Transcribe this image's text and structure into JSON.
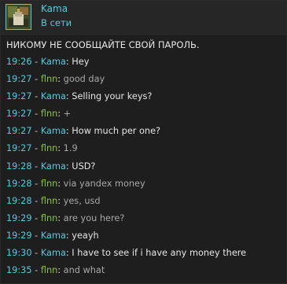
{
  "contact": {
    "name": "Kama",
    "status": "В сети"
  },
  "warning": "НИКОМУ НЕ СООБЩАЙТЕ СВОЙ ПАРОЛЬ.",
  "separator": " - ",
  "colon": ":",
  "messages": [
    {
      "time": "19:26",
      "author": "Kama",
      "text": "Hey"
    },
    {
      "time": "19:27",
      "author": "flnn",
      "text": "good day"
    },
    {
      "time": "19:27",
      "author": "Kama",
      "text": "Selling your keys?"
    },
    {
      "time": "19:27",
      "author": "flnn",
      "text": "+"
    },
    {
      "time": "19:27",
      "author": "Kama",
      "text": "How much per one?"
    },
    {
      "time": "19:27",
      "author": "flnn",
      "text": "1.9"
    },
    {
      "time": "19:28",
      "author": "Kama",
      "text": "USD?"
    },
    {
      "time": "19:28",
      "author": "flnn",
      "text": "via yandex money"
    },
    {
      "time": "19:28",
      "author": "flnn",
      "text": "yes, usd"
    },
    {
      "time": "19:29",
      "author": "flnn",
      "text": "are you here?"
    },
    {
      "time": "19:29",
      "author": "Kama",
      "text": "yeayh"
    },
    {
      "time": "19:30",
      "author": "Kama",
      "text": "I have to see if i have any money there"
    },
    {
      "time": "19:35",
      "author": "flnn",
      "text": "and what"
    }
  ],
  "colors": {
    "background": "#1e1e1e",
    "accent": "#57cbde",
    "friend_name": "#8bc53f",
    "text": "#e6e6e6",
    "muted_text": "#a8a8a8"
  }
}
